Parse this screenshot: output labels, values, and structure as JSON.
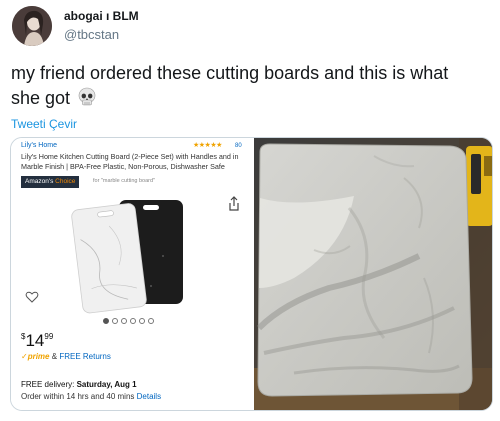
{
  "user": {
    "display_name": "abogai ı BLM",
    "handle": "@tbcstan",
    "avatar_icon": "profile-photo"
  },
  "tweet": {
    "text": "my friend ordered these cutting boards and this is what she got",
    "emoji": "skull-emoji",
    "translate_label": "Tweeti Çevir"
  },
  "product": {
    "brand": "Lily's Home",
    "rating_stars": "★★★★★",
    "rating_count": "80",
    "title": "Lily's Home Kitchen Cutting Board (2-Piece Set) with Handles and in Marble Finish | BPA-Free Plastic, Non-Porous, Dishwasher Safe",
    "choice_prefix": "Amazon's",
    "choice_word": "Choice",
    "choice_for": "for \"marble cutting board\"",
    "image_dots": 6,
    "active_dot": 0,
    "price_currency": "$",
    "price_whole": "14",
    "price_fraction": "99",
    "prime_mark": "✓prime",
    "prime_amp": "&",
    "free_returns": "FREE Returns",
    "delivery_prefix": "FREE delivery:",
    "delivery_date": "Saturday, Aug 1",
    "order_text": "Order within 14 hrs and 40 mins",
    "details_link": "Details"
  },
  "colors": {
    "link": "#1b95e0",
    "amazon_link": "#0066c0",
    "amazon_orange": "#f08804",
    "amazon_dark": "#232f3e",
    "star": "#f0a300"
  }
}
